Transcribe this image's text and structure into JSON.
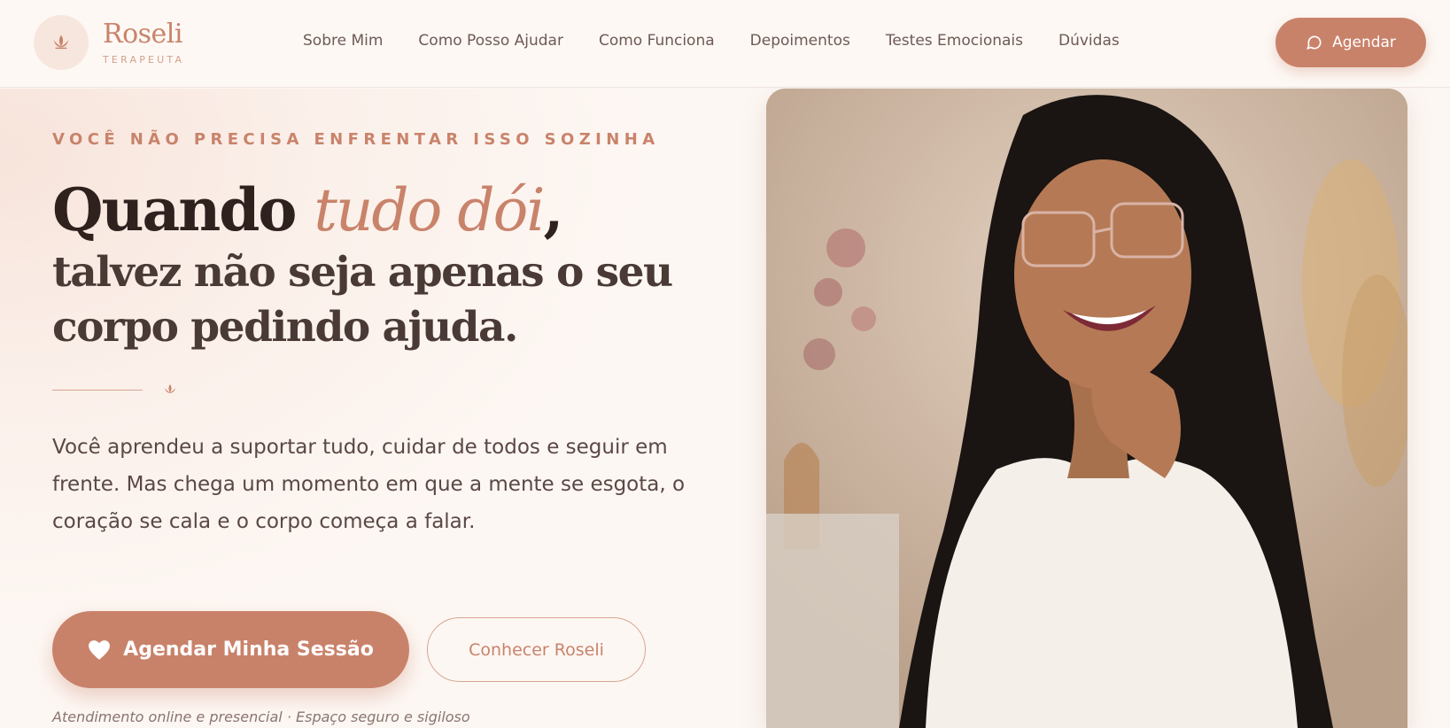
{
  "brand": {
    "name": "Roseli",
    "subtitle": "TERAPEUTA"
  },
  "nav": {
    "items": [
      {
        "label": "Sobre Mim"
      },
      {
        "label": "Como Posso Ajudar"
      },
      {
        "label": "Como Funciona"
      },
      {
        "label": "Depoimentos"
      },
      {
        "label": "Testes Emocionais"
      },
      {
        "label": "Dúvidas"
      }
    ],
    "cta_label": "Agendar"
  },
  "hero": {
    "eyebrow": "VOCÊ NÃO PRECISA ENFRENTAR ISSO SOZINHA",
    "title_start": "Quando ",
    "title_accent": "tudo dói",
    "title_comma": ",",
    "title_rest": "talvez não seja apenas o seu corpo pedindo ajuda.",
    "lead": "Você aprendeu a suportar tudo, cuidar de todos e seguir em frente. Mas chega um momento em que a mente se esgota, o coração se cala e o corpo começa a falar.",
    "primary_button": "Agendar Minha Sessão",
    "secondary_button": "Conhecer Roseli",
    "footnote": "Atendimento online e presencial · Espaço seguro e sigiloso"
  },
  "icons": {
    "logo": "lotus-icon",
    "cta": "chat-bubble-icon",
    "divider": "lotus-icon",
    "primary": "heart-icon"
  },
  "colors": {
    "accent": "#c9826a",
    "background": "#fdf7f3",
    "heading": "#2f211e"
  }
}
